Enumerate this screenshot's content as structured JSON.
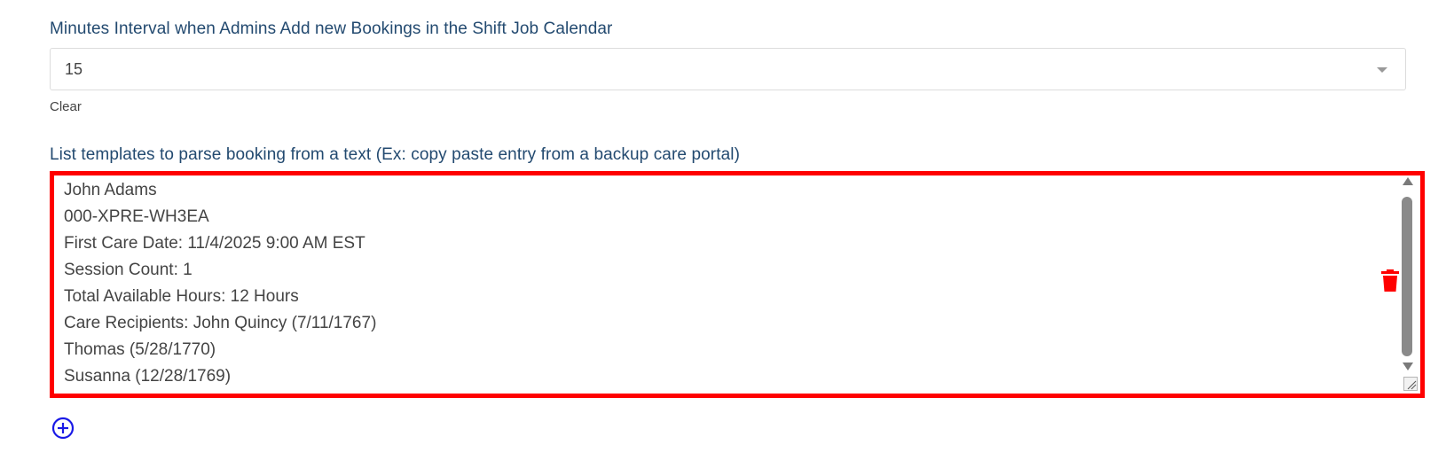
{
  "interval_setting": {
    "label": "Minutes Interval when Admins Add new Bookings in the Shift Job Calendar",
    "selected_value": "15",
    "clear_label": "Clear"
  },
  "templates_setting": {
    "label": "List templates to parse booking from a text (Ex: copy paste entry from a backup care portal)",
    "template_lines": [
      "John Adams",
      "000-XPRE-WH3EA",
      "First Care Date: 11/4/2025 9:00 AM EST",
      "Session Count: 1",
      "Total Available Hours: 12 Hours",
      "Care Recipients: John Quincy (7/11/1767)",
      "Thomas (5/28/1770)",
      "Susanna (12/28/1769)"
    ],
    "delete_icon": "trash-icon",
    "add_icon": "plus-circle-icon"
  },
  "colors": {
    "label_text": "#234a70",
    "highlight_border": "#ff0000",
    "delete_icon": "#ff0000",
    "add_icon": "#1a1ae6"
  }
}
